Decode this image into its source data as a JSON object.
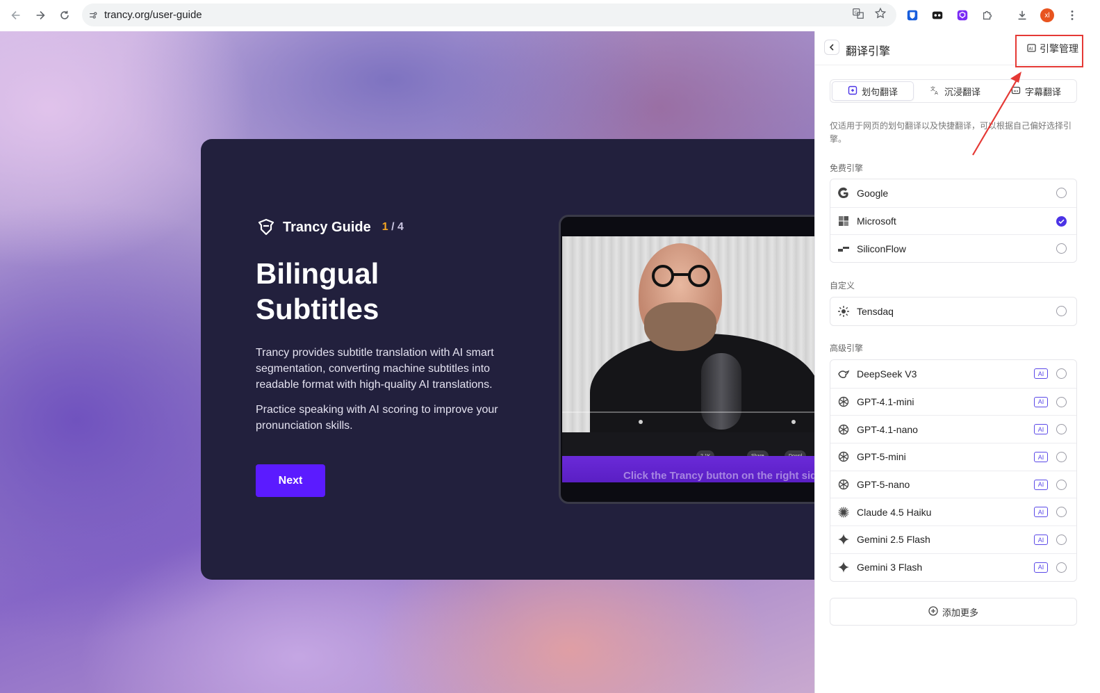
{
  "browser": {
    "url": "trancy.org/user-guide",
    "avatar_initials": "xl"
  },
  "guide": {
    "brand": "Trancy Guide",
    "step_current": "1",
    "step_sep_total": " / 4",
    "title": "Bilingual Subtitles",
    "paragraph1": "Trancy provides subtitle translation with AI smart segmentation, converting machine subtitles into readable format with high-quality AI translations.",
    "paragraph2": "Practice speaking with AI scoring to improve your pronunciation skills.",
    "next_label": "Next",
    "video": {
      "likes": "2.1K",
      "share": "Share",
      "download": "Downl",
      "subtitle": "Click the Trancy button on the right side"
    }
  },
  "panel": {
    "title": "翻译引擎",
    "manage_label": "引擎管理",
    "tabs": [
      {
        "label": "划句翻译",
        "active": true
      },
      {
        "label": "沉浸翻译",
        "active": false
      },
      {
        "label": "字幕翻译",
        "active": false
      }
    ],
    "description": "仅适用于网页的划句翻译以及快捷翻译，可以根据自己偏好选择引擎。",
    "sections": {
      "free": {
        "label": "免费引擎",
        "items": [
          {
            "name": "Google",
            "icon": "google-icon",
            "selected": false
          },
          {
            "name": "Microsoft",
            "icon": "microsoft-icon",
            "selected": true
          },
          {
            "name": "SiliconFlow",
            "icon": "siliconflow-icon",
            "selected": false
          }
        ]
      },
      "custom": {
        "label": "自定义",
        "items": [
          {
            "name": "Tensdaq",
            "icon": "tensdaq-icon",
            "selected": false
          }
        ]
      },
      "advanced": {
        "label": "高级引擎",
        "badge": "AI",
        "items": [
          {
            "name": "DeepSeek V3",
            "icon": "deepseek-icon",
            "selected": false
          },
          {
            "name": "GPT-4.1-mini",
            "icon": "openai-icon",
            "selected": false
          },
          {
            "name": "GPT-4.1-nano",
            "icon": "openai-icon",
            "selected": false
          },
          {
            "name": "GPT-5-mini",
            "icon": "openai-icon",
            "selected": false
          },
          {
            "name": "GPT-5-nano",
            "icon": "openai-icon",
            "selected": false
          },
          {
            "name": "Claude 4.5 Haiku",
            "icon": "claude-icon",
            "selected": false
          },
          {
            "name": "Gemini 2.5 Flash",
            "icon": "gemini-icon",
            "selected": false
          },
          {
            "name": "Gemini 3 Flash",
            "icon": "gemini-icon",
            "selected": false
          }
        ]
      }
    },
    "add_more_label": "添加更多"
  },
  "colors": {
    "accent": "#5b1bff",
    "radio_checked": "#4b33e6",
    "ai_badge": "#5a48e8",
    "annotation_red": "#e53935"
  }
}
